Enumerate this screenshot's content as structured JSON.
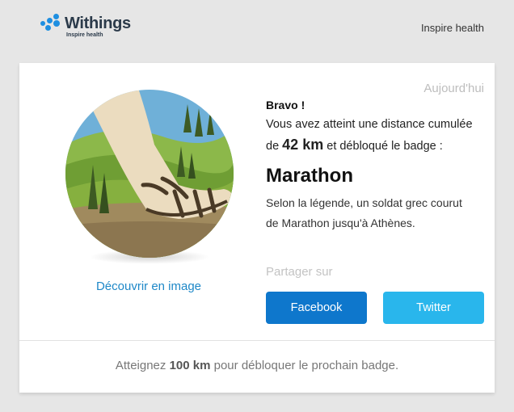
{
  "header": {
    "brand_name": "Withings",
    "brand_tagline": "Inspire health",
    "right_text": "Inspire health"
  },
  "card": {
    "date": "Aujourd'hui",
    "greeting": "Bravo !",
    "description_start": "Vous avez atteint une distance cumulée de",
    "distance": "42 km",
    "description_end": "et débloqué le badge :",
    "badge_name": "Marathon",
    "legend": "Selon la légende, un soldat grec courut de Marathon jusqu'à Athènes.",
    "discover_link": "Découvrir en image",
    "share_label": "Partager sur",
    "facebook_label": "Facebook",
    "twitter_label": "Twitter"
  },
  "footer": {
    "prefix": "Atteignez",
    "distance": "100 km",
    "suffix": "pour débloquer le prochain badge."
  },
  "colors": {
    "brand_blue": "#1e8fe1",
    "link_blue": "#1e88c8",
    "facebook": "#0e77cc",
    "twitter": "#29b6ec"
  },
  "icons": {
    "badge": "marathon-sandal-foot-illustration",
    "logo": "withings-dots-logo"
  }
}
